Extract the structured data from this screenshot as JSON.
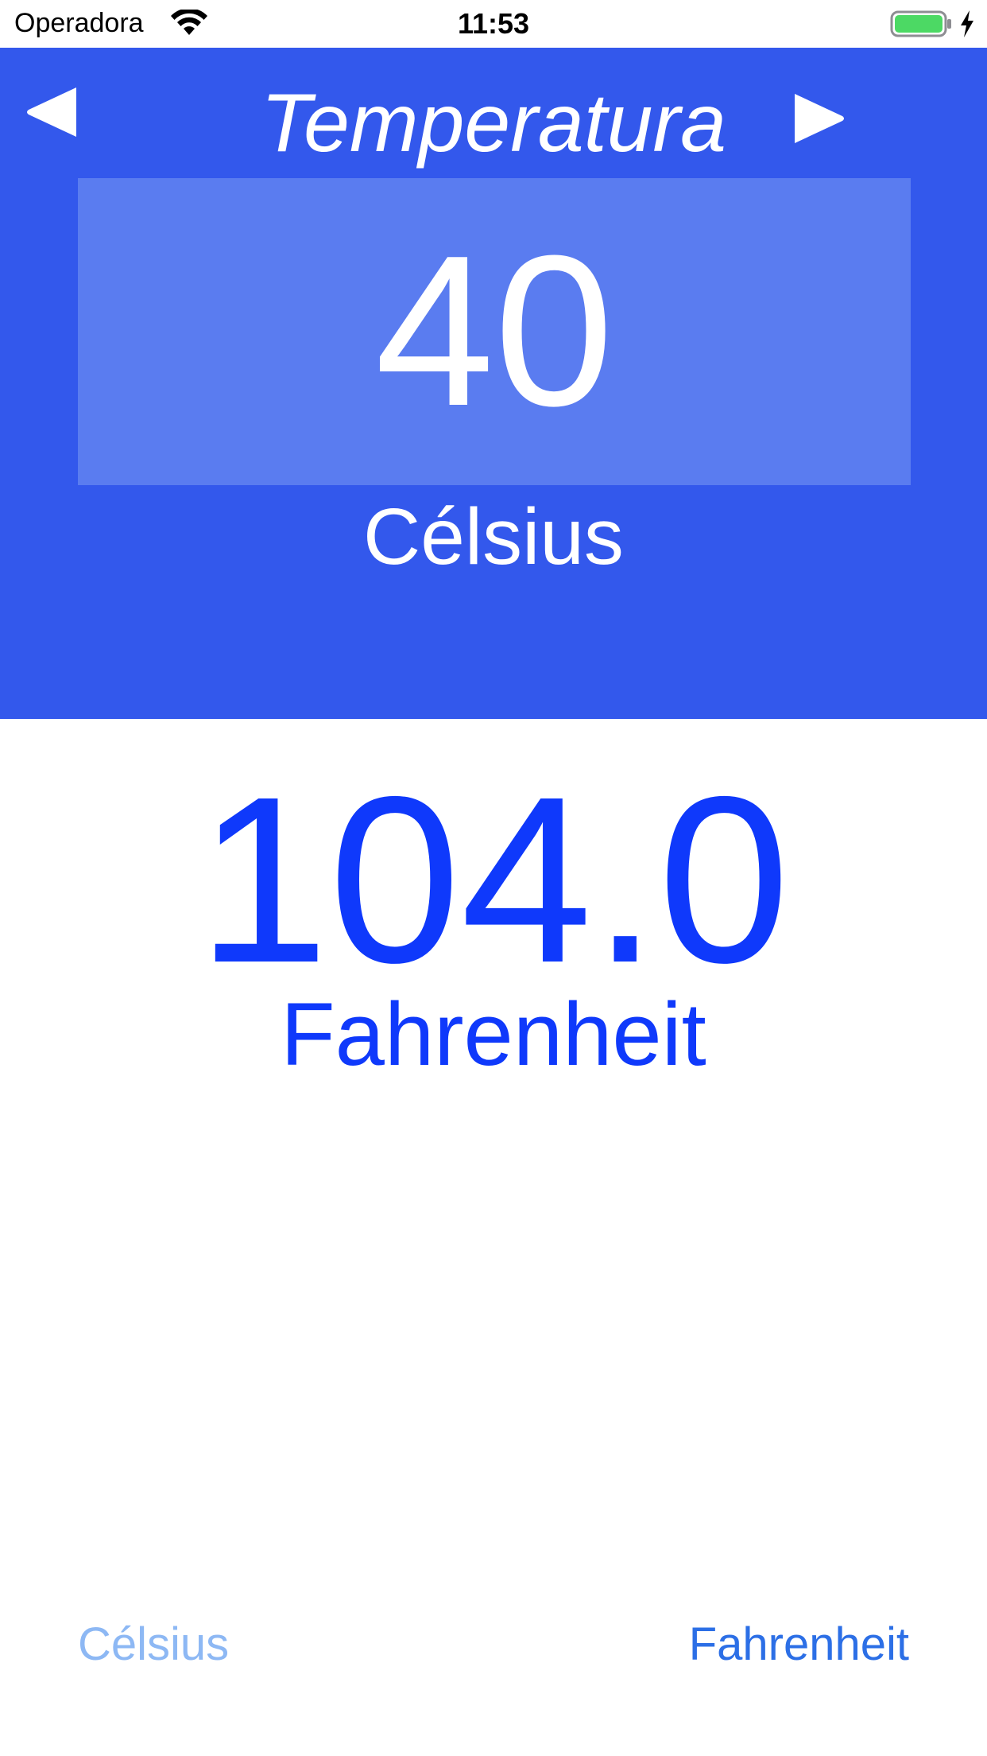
{
  "status_bar": {
    "carrier": "Operadora",
    "time": "11:53",
    "wifi_icon": "wifi-icon",
    "battery_icon": "battery-charging-icon",
    "battery_level": 1.0
  },
  "header": {
    "title": "Temperatura",
    "prev_icon": "triangle-left-icon",
    "next_icon": "triangle-right-icon",
    "input_value": "40",
    "input_unit": "Célsius"
  },
  "result": {
    "value": "104.0",
    "unit": "Fahrenheit"
  },
  "unit_selector": {
    "options": [
      {
        "label": "Célsius",
        "state": "inactive"
      },
      {
        "label": "Fahrenheit",
        "state": "active"
      }
    ]
  },
  "colors": {
    "header_bg": "#3358EC",
    "input_box_bg": "#5A7CF0",
    "result_text": "#0F39FB",
    "active_option": "#2C6FE6",
    "inactive_option": "#8DB8F4",
    "battery_fill": "#4CD964"
  }
}
